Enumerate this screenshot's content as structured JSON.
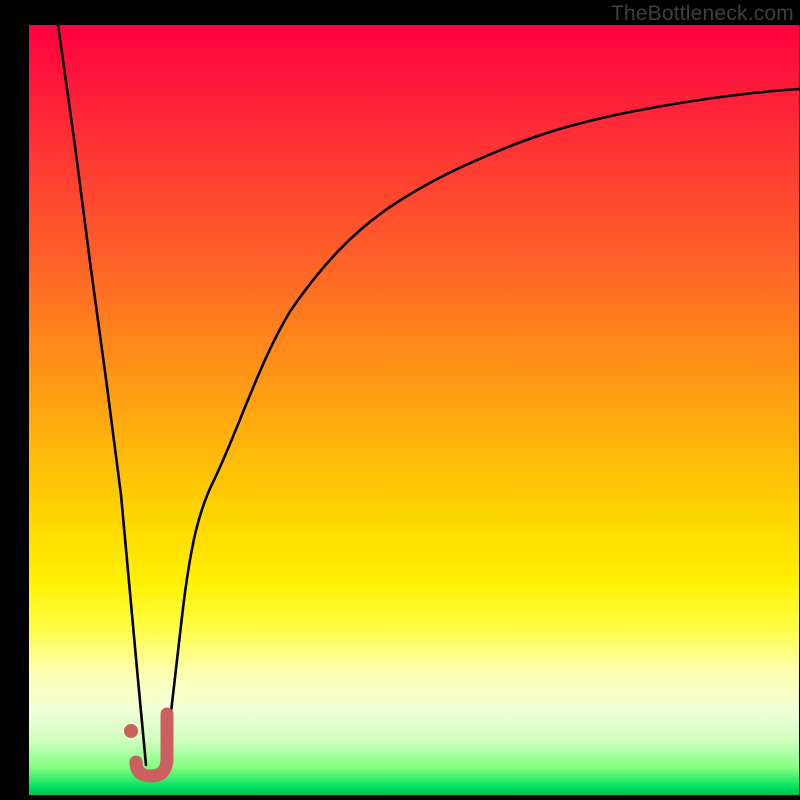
{
  "attribution": "TheBottleneck.com",
  "colors": {
    "frame": "#000000",
    "curve": "#000000",
    "marker_stroke": "#cc6060",
    "marker_fill": "#cc6060",
    "gradient_top": "#ff0040",
    "gradient_bottom": "#00c050"
  },
  "chart_data": {
    "type": "line",
    "title": "",
    "xlabel": "",
    "ylabel": "",
    "xlim": [
      0,
      100
    ],
    "ylim": [
      0,
      100
    ],
    "grid": false,
    "series": [
      {
        "name": "left-branch",
        "x": [
          3.8,
          6,
          8,
          10,
          12,
          14,
          15.2
        ],
        "y": [
          100,
          84,
          69,
          54,
          39,
          16,
          4
        ]
      },
      {
        "name": "right-branch",
        "x": [
          17.5,
          18,
          19,
          20,
          22,
          24,
          27,
          30,
          34,
          38,
          43,
          48,
          54,
          60,
          67,
          75,
          83,
          91,
          100
        ],
        "y": [
          3,
          8,
          16,
          24,
          37,
          47,
          57,
          64,
          70,
          74.5,
          78.5,
          81.5,
          84,
          86,
          87.7,
          89.2,
          90.2,
          90.9,
          91.6
        ]
      }
    ],
    "marker": {
      "name": "J-shape",
      "approx_position_x": 16.5,
      "approx_position_y": 4
    }
  }
}
